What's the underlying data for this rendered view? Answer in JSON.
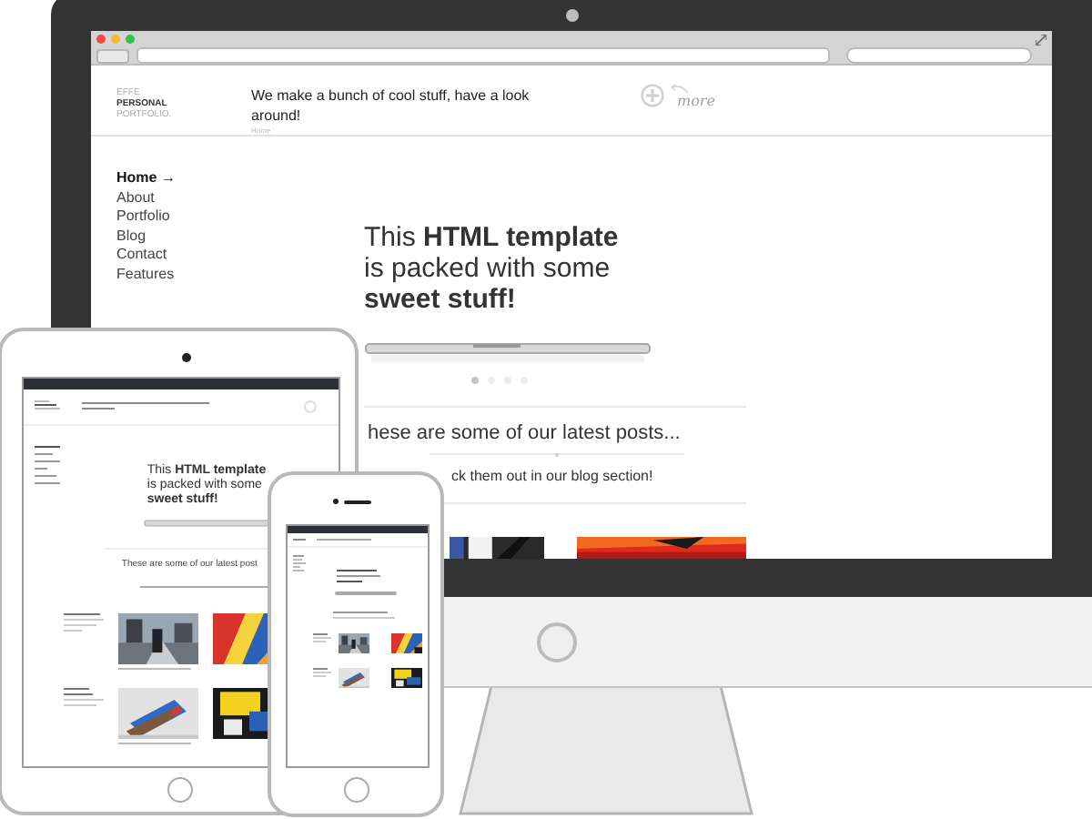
{
  "desktop": {
    "logo": [
      "EFFE",
      "PERSONAL",
      "PORTFOLIO."
    ],
    "tagline": "We make a bunch of cool stuff, have a look around!",
    "breadcrumb": "Home",
    "more_label": "more",
    "nav": [
      {
        "label": "Home →",
        "selected": true
      },
      {
        "label": "About",
        "selected": false
      },
      {
        "label": "Portfolio",
        "selected": false
      },
      {
        "label": "Blog",
        "selected": false
      },
      {
        "label": "Contact",
        "selected": false
      },
      {
        "label": "Features",
        "selected": false
      }
    ],
    "hero": [
      "This **HTML template**",
      "is packed with some",
      "**sweet stuff!**"
    ],
    "slides": [
      {
        "selected": true
      },
      {
        "selected": false
      },
      {
        "selected": false
      },
      {
        "selected": false
      }
    ],
    "latest_heading": "hese are some of our latest posts...",
    "latest_subheading": "ck them out in our blog section!"
  },
  "tablet": {
    "hero": [
      "This **HTML template**",
      "is packed with some",
      "**sweet stuff!**"
    ],
    "latest_heading": "These are some of our latest post"
  }
}
